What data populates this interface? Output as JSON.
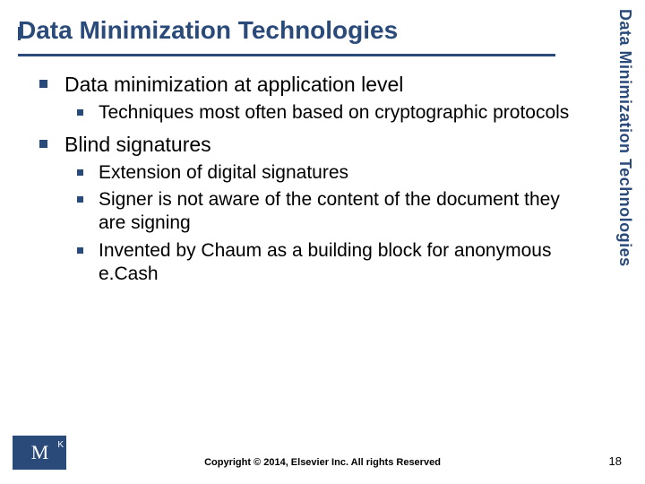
{
  "title": "Data Minimization Technologies",
  "sidebar_label": "Data Minimization Technologies",
  "bullets": {
    "b1": "Data minimization at application level",
    "b1_1": "Techniques most often based on cryptographic protocols",
    "b2": "Blind signatures",
    "b2_1": "Extension of digital signatures",
    "b2_2": "Signer is not aware of the content of the document they are signing",
    "b2_3": "Invented by Chaum as a building block for anonymous e.Cash"
  },
  "footer": {
    "copyright": "Copyright © 2014, Elsevier Inc. All rights Reserved",
    "page": "18",
    "logo_m": "M",
    "logo_k": "K"
  }
}
